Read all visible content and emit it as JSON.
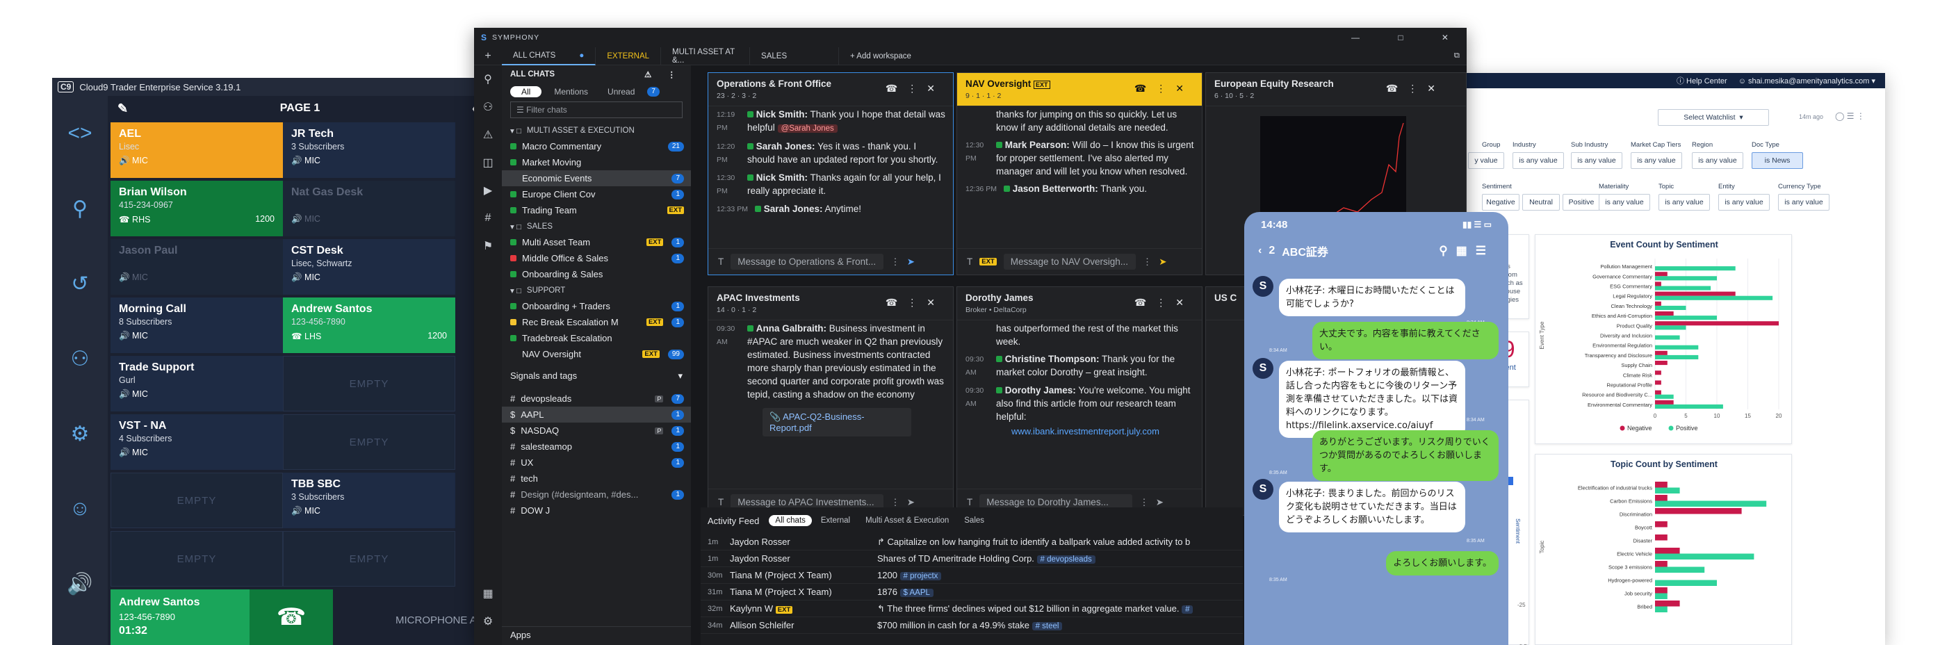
{
  "c9": {
    "title": "Cloud9 Trader Enterprise Service 3.19.1",
    "logo": "C9",
    "page": "PAGE 1",
    "tiles": [
      {
        "name": "AEL",
        "sub": "Lisec",
        "status": "MIC",
        "color": "#f2a11f",
        "right": ""
      },
      {
        "name": "JR Tech",
        "sub": "3 Subscribers",
        "status": "MIC",
        "color": "#1e2b44",
        "right": ""
      },
      {
        "name": "Brian Wilson",
        "sub": "415-234-0967",
        "status": "RHS",
        "color": "#0f7a3a",
        "right": "1200"
      },
      {
        "name": "Nat Gas Desk",
        "sub": "",
        "status": "MIC",
        "color": "#1c2637",
        "right": "",
        "dim": true
      },
      {
        "name": "Jason Paul",
        "sub": "",
        "status": "MIC",
        "color": "#1c2637",
        "right": "",
        "dim": true
      },
      {
        "name": "CST Desk",
        "sub": "Lisec, Schwartz",
        "status": "MIC",
        "color": "#1e2b44",
        "right": ""
      },
      {
        "name": "Morning Call",
        "sub": "8 Subscribers",
        "status": "MIC",
        "color": "#1e2b44",
        "right": ""
      },
      {
        "name": "Andrew Santos",
        "sub": "123-456-7890",
        "status": "LHS",
        "color": "#1aa55a",
        "right": "1200"
      },
      {
        "name": "Trade Support",
        "sub": "Gurl",
        "status": "MIC",
        "color": "#1e2b44",
        "right": ""
      },
      {
        "empty": "EMPTY"
      },
      {
        "name": "VST - NA",
        "sub": "4 Subscribers",
        "status": "MIC",
        "color": "#1e2b44",
        "right": ""
      },
      {
        "empty": "EMPTY"
      },
      {
        "empty": "EMPTY"
      },
      {
        "name": "TBB SBC",
        "sub": "3 Subscribers",
        "status": "MIC",
        "color": "#1e2b44",
        "right": ""
      },
      {
        "empty": "EMPTY"
      },
      {
        "empty": "EMPTY"
      }
    ],
    "call": {
      "name": "Andrew Santos",
      "number": "123-456-7890",
      "time": "01:32"
    },
    "microphone": "MICROPHONE A"
  },
  "symphony": {
    "app": "SYMPHONY",
    "workspaces": [
      "ALL CHATS",
      "EXTERNAL",
      "MULTI ASSET AT &...",
      "SALES"
    ],
    "add_workspace": "+ Add workspace",
    "sidebar_title": "ALL CHATS",
    "filters": [
      "All",
      "Mentions",
      "Unread"
    ],
    "unread_count": "7",
    "filter_placeholder": "Filter chats",
    "sections": [
      {
        "title": "MULTI ASSET & EXECUTION",
        "items": [
          {
            "label": "Macro Commentary",
            "badge": "21",
            "dot": "g"
          },
          {
            "label": "Market Moving",
            "badge": "",
            "dot": "g"
          },
          {
            "label": "Economic Events",
            "badge": "7",
            "dot": ""
          },
          {
            "label": "Europe Client Cov",
            "badge": "1",
            "dot": "g"
          },
          {
            "label": "Trading Team",
            "badge": "",
            "dot": "g",
            "ext": "EXT"
          }
        ]
      },
      {
        "title": "SALES",
        "items": [
          {
            "label": "Multi Asset Team",
            "badge": "1",
            "dot": "g",
            "ext": "EXT"
          },
          {
            "label": "Middle Office & Sales",
            "badge": "1",
            "dot": "r"
          },
          {
            "label": "Onboarding & Sales",
            "badge": "",
            "dot": "g"
          }
        ]
      },
      {
        "title": "SUPPORT",
        "items": [
          {
            "label": "Onboarding + Traders",
            "badge": "1",
            "dot": "g"
          },
          {
            "label": "Rec Break Escalation M",
            "badge": "1",
            "dot": "y",
            "ext": "EXT"
          },
          {
            "label": "Tradebreak Escalation",
            "badge": "",
            "dot": "g"
          },
          {
            "label": "NAV Oversight",
            "badge": "99",
            "dot": "",
            "ext": "EXT"
          }
        ]
      }
    ],
    "signals_title": "Signals and tags",
    "tags": [
      {
        "label": "devopsleads",
        "badge": "7",
        "p": "P"
      },
      {
        "label": "AAPL",
        "badge": "1",
        "p": ""
      },
      {
        "label": "NASDAQ",
        "badge": "1",
        "p": "P"
      },
      {
        "label": "salesteamop",
        "badge": "1",
        "p": ""
      },
      {
        "label": "UX",
        "badge": "1",
        "p": ""
      },
      {
        "label": "tech",
        "badge": "",
        "p": ""
      },
      {
        "label": "Design (#designteam, #des...",
        "badge": "1",
        "p": ""
      },
      {
        "label": "DOW J",
        "badge": "",
        "p": ""
      }
    ],
    "apps_label": "Apps",
    "panes": {
      "ops": {
        "title": "Operations & Front Office",
        "meta": "23 · 2 · 3 · 2",
        "input": "Message to Operations & Front...",
        "msgs": [
          {
            "t": "12:19 PM",
            "who": "Nick Smith:",
            "text": "Thank you I hope that detail was helpful",
            "mention": "@Sarah Jones"
          },
          {
            "t": "12:20 PM",
            "who": "Sarah Jones:",
            "text": "Yes it was - thank you. I should have an updated report for you shortly."
          },
          {
            "t": "12:30 PM",
            "who": "Nick Smith:",
            "text": "Thanks again for all your help, I really appreciate it."
          },
          {
            "t": "12:33 PM",
            "who": "Sarah Jones:",
            "text": "Anytime!"
          }
        ]
      },
      "nav": {
        "title": "NAV Oversight",
        "ext": "EXT",
        "meta": "9 · 1 · 1 · 2",
        "input": "Message to NAV Oversigh...",
        "msgs": [
          {
            "t": "",
            "who": "",
            "text": "thanks for jumping on this so quickly. Let us know if any additional details are needed."
          },
          {
            "t": "12:30 PM",
            "who": "Mark Pearson:",
            "text": "Will do – I know this is urgent for proper settlement. I've also alerted my manager and will let you know when resolved."
          },
          {
            "t": "12:36 PM",
            "who": "Jason Betterworth:",
            "text": "Thank you."
          }
        ]
      },
      "eu": {
        "title": "European Equity Research",
        "meta": "6 · 10 · 5 · 2"
      },
      "apac": {
        "title": "APAC Investments",
        "meta": "14 · 0 · 1 · 2",
        "input": "Message to APAC Investments...",
        "msgs": [
          {
            "t": "09:30 AM",
            "who": "Anna Galbraith:",
            "text": "Business investment in #APAC are much weaker in Q2 than previously estimated. Business investments contracted more sharply than previously estimated in the second quarter and corporate profit growth was tepid, casting a shadow on the economy"
          }
        ],
        "file": "APAC-Q2-Business-Report.pdf"
      },
      "dorothy": {
        "title": "Dorothy James",
        "meta": "Broker • DeltaCorp",
        "input": "Message to Dorothy James...",
        "msgs": [
          {
            "t": "",
            "who": "",
            "text": "has outperformed the rest of the market this week."
          },
          {
            "t": "09:30 AM",
            "who": "Christine Thompson:",
            "text": "Thank you for the market color Dorothy – great insight."
          },
          {
            "t": "09:30 AM",
            "who": "Dorothy James:",
            "text": "You're welcome. You might also find this article from our research team helpful:"
          }
        ],
        "link": "www.ibank.investmentreport.july.com"
      },
      "usc": {
        "title": "US C"
      }
    },
    "feed": {
      "title": "Activity Feed",
      "tabs": [
        "All chats",
        "External",
        "Multi Asset & Execution",
        "Sales"
      ],
      "rows": [
        {
          "t": "1m",
          "n": "Jaydon Rosser",
          "text": "↱ Capitalize on low hanging fruit to identify a ballpark value added activity to b",
          "tag": ""
        },
        {
          "t": "1m",
          "n": "Jaydon Rosser",
          "text": "Shares of TD Ameritrade Holding Corp.",
          "tag": "# devopsleads"
        },
        {
          "t": "30m",
          "n": "Tiana M (Project X Team)",
          "text": "1200",
          "tag": "# projectx"
        },
        {
          "t": "31m",
          "n": "Tiana M (Project X Team)",
          "text": "1876",
          "tag": "$ AAPL"
        },
        {
          "t": "32m",
          "n": "Kaylynn W",
          "text": "↰ The three firms' declines wiped out $12 billion in aggregate market value.",
          "tag": "#",
          "ext": "EXT"
        },
        {
          "t": "34m",
          "n": "Allison Schleifer",
          "text": "$700 million in cash for a 49.9% stake",
          "tag": "# steel"
        }
      ]
    }
  },
  "phone": {
    "time": "14:48",
    "chat_title": "ABC証券",
    "back_count": "2",
    "messages": [
      {
        "side": "l",
        "text": "小林花子: 木曜日にお時間いただくことは可能でしょうか?",
        "stamp": "8:34 AM"
      },
      {
        "side": "r",
        "text": "大丈夫です。内容を事前に教えてください。",
        "stamp": "8:34 AM"
      },
      {
        "side": "l",
        "text": "小林花子: ポートフォリオの最新情報と、話し合った内容をもとに今後のリターン予測を準備させていただきました。以下は資料へのリンクになります。https://filelink.axservice.co/aiuyf",
        "stamp": "8:34 AM"
      },
      {
        "side": "r",
        "text": "ありがとうございます。リスク周りでいくつか質問があるのでよろしくお願いします。",
        "stamp": "8:35 AM"
      },
      {
        "side": "l",
        "text": "小林花子: 畏まりました。前回からのリスク変化も説明させていただきます。当日はどうぞよろしくお願いいたします。",
        "stamp": "8:35 AM"
      },
      {
        "side": "r",
        "text": "よろしくお願いします。",
        "stamp": "8:35 AM"
      }
    ]
  },
  "dash": {
    "help": "Help Center",
    "user": "shai.mesika@amenityanalytics.com",
    "watchlist": "Select Watchlist",
    "ago": "14m ago",
    "filters1": [
      {
        "label": "Group",
        "value": "y value"
      },
      {
        "label": "Industry",
        "value": "is any value"
      },
      {
        "label": "Sub Industry",
        "value": "is any value"
      },
      {
        "label": "Market Cap Tiers",
        "value": "is any value"
      },
      {
        "label": "Region",
        "value": "is any value"
      },
      {
        "label": "Doc Type",
        "value": "is News"
      }
    ],
    "filters2": [
      {
        "label": "Sentiment",
        "value": "Negative | Neutral | Positive"
      },
      {
        "label": "Materiality",
        "value": "is any value"
      },
      {
        "label": "Topic",
        "value": "is any value"
      },
      {
        "label": "Entity",
        "value": "is any value"
      },
      {
        "label": "Currency Type",
        "value": "is any value"
      }
    ],
    "text_snip": [
      "changes has",
      "to recover from",
      "f energy, such as",
      "",
      "uce greenhouse",
      "ce technologies"
    ],
    "big_number": "7.9",
    "big_label": "Sentiment",
    "legend": [
      "Negative",
      "Positive"
    ],
    "axis_side": "Sentiment"
  },
  "chart_data": [
    {
      "type": "bar",
      "title": "Event Count by Sentiment",
      "ylabel": "Event Type",
      "categories": [
        "Pollution Management",
        "Governance Commentary",
        "ESG Commentary",
        "Legal Regulatory",
        "Clean Technology",
        "Ethics and Anti-Corruption",
        "Product Quality",
        "Diversity and Inclusion",
        "Environmental Regulation",
        "Transparency and Disclosure",
        "Supply Chain",
        "Climate Risk",
        "Reputational Profile",
        "Resource and Biodiversity C...",
        "Environmental Commentary"
      ],
      "series": [
        {
          "name": "Negative",
          "color": "#c8194b",
          "values": [
            0,
            2,
            1,
            13,
            1,
            3,
            20,
            0,
            0,
            2,
            2,
            1,
            1,
            1,
            3
          ]
        },
        {
          "name": "Positive",
          "color": "#2fd39a",
          "values": [
            13,
            10,
            9,
            19,
            5,
            10,
            5,
            4,
            7,
            7,
            0,
            0,
            0,
            3,
            11
          ]
        }
      ],
      "xlim": [
        0,
        20
      ],
      "xticks": [
        0,
        5,
        10,
        15,
        20
      ]
    },
    {
      "type": "bar",
      "title": "Topic Count by Sentiment",
      "ylabel": "Topic",
      "categories": [
        "Electrification of industrial trucks",
        "Carbon Emissions",
        "Discrimination",
        "Boycott",
        "Disaster",
        "Electric Vehicle",
        "Scope 3 emissions",
        "Hydrogen-powered",
        "Job security",
        "Bribed"
      ],
      "series": [
        {
          "name": "Negative",
          "color": "#c8194b",
          "values": [
            1,
            1,
            7,
            1,
            1,
            2,
            1,
            0,
            1,
            2
          ]
        },
        {
          "name": "Positive",
          "color": "#2fd39a",
          "values": [
            2,
            9,
            0,
            0,
            0,
            8,
            4,
            5,
            1,
            1
          ]
        }
      ],
      "xlim": [
        0,
        10
      ]
    }
  ]
}
